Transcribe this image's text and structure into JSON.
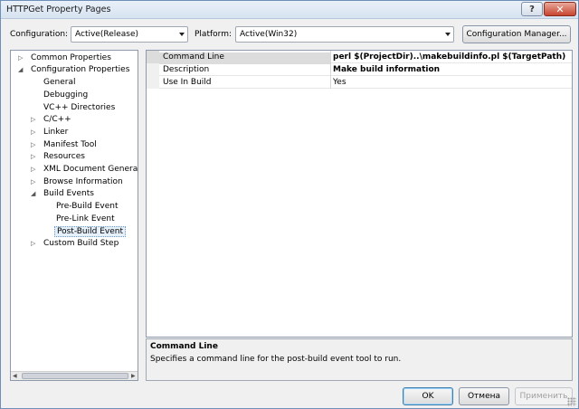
{
  "window": {
    "title": "HTTPGet Property Pages",
    "help_glyph": "?",
    "close_glyph": "✕"
  },
  "config": {
    "configuration_label": "Configuration:",
    "configuration_value": "Active(Release)",
    "platform_label": "Platform:",
    "platform_value": "Active(Win32)",
    "manager_button": "Configuration Manager..."
  },
  "tree": {
    "items": [
      {
        "label": "Common Properties",
        "toggle": "▷"
      },
      {
        "label": "Configuration Properties",
        "toggle": "◢"
      },
      {
        "label": "General",
        "toggle": ""
      },
      {
        "label": "Debugging",
        "toggle": ""
      },
      {
        "label": "VC++ Directories",
        "toggle": ""
      },
      {
        "label": "C/C++",
        "toggle": "▷"
      },
      {
        "label": "Linker",
        "toggle": "▷"
      },
      {
        "label": "Manifest Tool",
        "toggle": "▷"
      },
      {
        "label": "Resources",
        "toggle": "▷"
      },
      {
        "label": "XML Document Generator",
        "toggle": "▷"
      },
      {
        "label": "Browse Information",
        "toggle": "▷"
      },
      {
        "label": "Build Events",
        "toggle": "◢"
      },
      {
        "label": "Pre-Build Event",
        "toggle": ""
      },
      {
        "label": "Pre-Link Event",
        "toggle": ""
      },
      {
        "label": "Post-Build Event",
        "toggle": ""
      },
      {
        "label": "Custom Build Step",
        "toggle": "▷"
      }
    ],
    "scroll_left": "◀",
    "scroll_right": "▶"
  },
  "properties": {
    "rows": [
      {
        "name": "Command Line",
        "value": "perl $(ProjectDir)..\\makebuildinfo.pl $(TargetPath)"
      },
      {
        "name": "Description",
        "value": "Make build information"
      },
      {
        "name": "Use In Build",
        "value": "Yes"
      }
    ]
  },
  "description": {
    "title": "Command Line",
    "text": "Specifies a command line for the post-build event tool to run."
  },
  "buttons": {
    "ok": "OK",
    "cancel": "Отмена",
    "apply": "Применить"
  }
}
